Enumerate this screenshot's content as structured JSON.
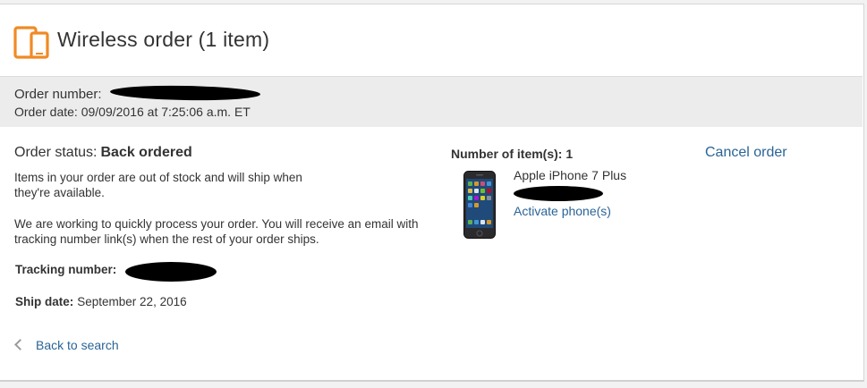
{
  "header": {
    "title": "Wireless order (1 item)",
    "icon": "wireless-devices-icon",
    "accent_color": "#f08a24"
  },
  "order_info": {
    "number_label": "Order number:",
    "date_text": "Order date: 09/09/2016 at 7:25:06 a.m. ET"
  },
  "status": {
    "label": "Order status:",
    "value": "Back ordered",
    "message_1": "Items in your order are out of stock and will ship when they're available.",
    "message_2": "We are working to quickly process your order. You will receive an email with tracking number link(s) when the rest of your order ships."
  },
  "tracking": {
    "label": "Tracking number:"
  },
  "ship": {
    "label": "Ship date:",
    "value": "September 22, 2016"
  },
  "items": {
    "count_text": "Number of item(s): 1",
    "product_name": "Apple iPhone 7 Plus",
    "activate_label": "Activate phone(s)"
  },
  "actions": {
    "cancel_label": "Cancel order",
    "back_label": "Back to search"
  },
  "colors": {
    "link": "#2a6496",
    "info_bar_bg": "#ececec"
  }
}
